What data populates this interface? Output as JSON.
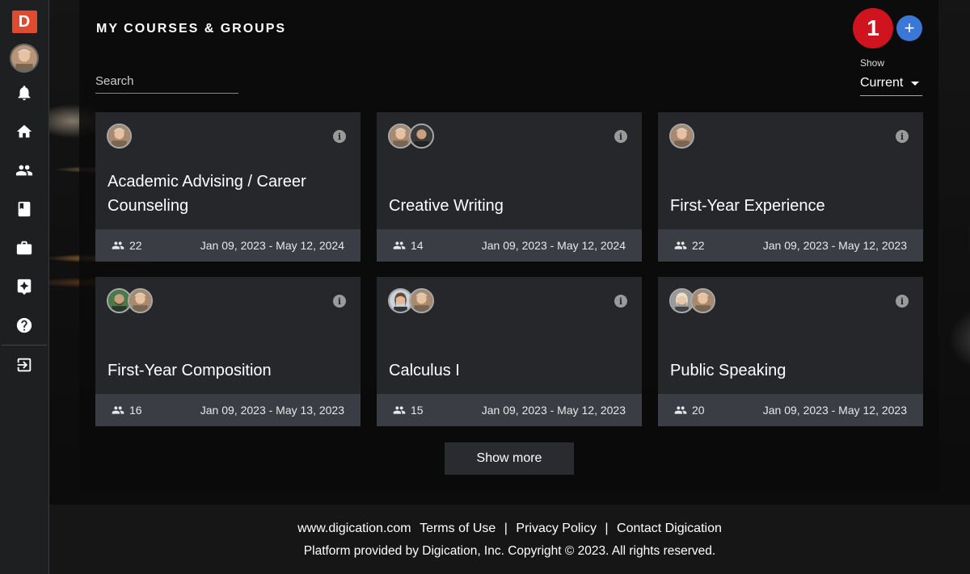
{
  "app": {
    "logo_letter": "D"
  },
  "page": {
    "title": "MY COURSES & GROUPS"
  },
  "search": {
    "placeholder": "Search"
  },
  "notification": {
    "count": "1"
  },
  "add": {
    "label": "+"
  },
  "filter": {
    "label": "Show",
    "value": "Current"
  },
  "courses": [
    {
      "title": "Academic Advising / Career Counseling",
      "members": "22",
      "dates": "Jan 09, 2023 - May 12, 2024"
    },
    {
      "title": "Creative Writing",
      "members": "14",
      "dates": "Jan 09, 2023 - May 12, 2024"
    },
    {
      "title": "First-Year Experience",
      "members": "22",
      "dates": "Jan 09, 2023 - May 12, 2023"
    },
    {
      "title": "First-Year Composition",
      "members": "16",
      "dates": "Jan 09, 2023 - May 13, 2023"
    },
    {
      "title": "Calculus I",
      "members": "15",
      "dates": "Jan 09, 2023 - May 12, 2023"
    },
    {
      "title": "Public Speaking",
      "members": "20",
      "dates": "Jan 09, 2023 - May 12, 2023"
    }
  ],
  "show_more": "Show more",
  "footer": {
    "site": "www.digication.com",
    "terms": "Terms of Use",
    "privacy": "Privacy Policy",
    "contact": "Contact Digication",
    "separator": "|",
    "copyright": "Platform provided by Digication, Inc. Copyright © 2023. All rights reserved."
  },
  "icons": {
    "sidebar": [
      "bell-icon",
      "home-icon",
      "people-icon",
      "book-icon",
      "briefcase-icon",
      "feedback-icon",
      "help-icon",
      "logout-icon"
    ]
  },
  "colors": {
    "badge": "#d0141f",
    "add": "#3a77d6",
    "logo": "#e04a2e"
  }
}
